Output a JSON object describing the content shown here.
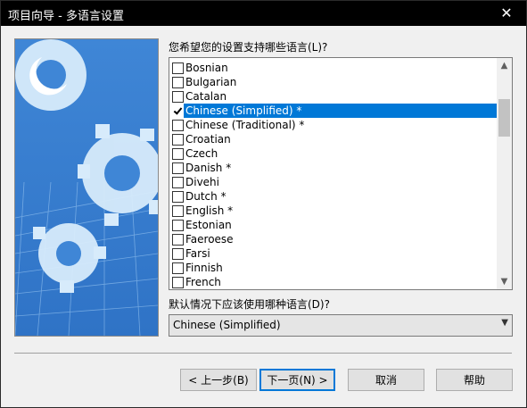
{
  "window": {
    "title": "项目向导 - 多语言设置",
    "close_glyph": "✕"
  },
  "question_label": "您希望您的设置支持哪些语言(L)?",
  "languages": [
    {
      "label": "Bosnian",
      "checked": false,
      "selected": false
    },
    {
      "label": "Bulgarian",
      "checked": false,
      "selected": false
    },
    {
      "label": "Catalan",
      "checked": false,
      "selected": false
    },
    {
      "label": "Chinese (Simplified) *",
      "checked": true,
      "selected": true
    },
    {
      "label": "Chinese (Traditional) *",
      "checked": false,
      "selected": false
    },
    {
      "label": "Croatian",
      "checked": false,
      "selected": false
    },
    {
      "label": "Czech",
      "checked": false,
      "selected": false
    },
    {
      "label": "Danish *",
      "checked": false,
      "selected": false
    },
    {
      "label": "Divehi",
      "checked": false,
      "selected": false
    },
    {
      "label": "Dutch *",
      "checked": false,
      "selected": false
    },
    {
      "label": "English *",
      "checked": false,
      "selected": false
    },
    {
      "label": "Estonian",
      "checked": false,
      "selected": false
    },
    {
      "label": "Faeroese",
      "checked": false,
      "selected": false
    },
    {
      "label": "Farsi",
      "checked": false,
      "selected": false
    },
    {
      "label": "Finnish",
      "checked": false,
      "selected": false
    },
    {
      "label": "French",
      "checked": false,
      "selected": false
    }
  ],
  "default_label": "默认情况下应该使用哪种语言(D)?",
  "default_language": "Chinese (Simplified)",
  "buttons": {
    "back": "< 上一步(B)",
    "next": "下一页(N) >",
    "cancel": "取消",
    "help": "帮助"
  },
  "colors": {
    "selection": "#0078d7",
    "titlebar": "#000000"
  }
}
